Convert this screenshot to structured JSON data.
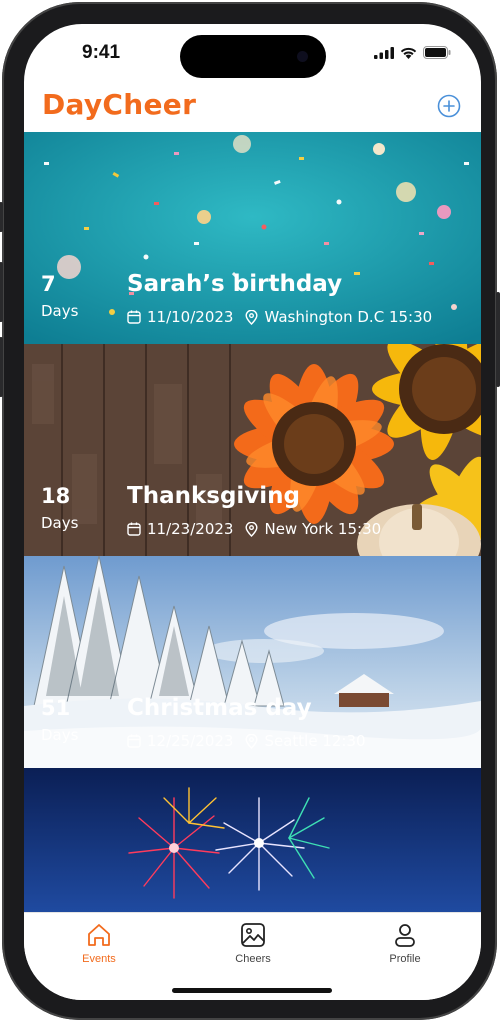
{
  "status_bar": {
    "time": "9:41"
  },
  "app": {
    "title": "DayCheer"
  },
  "header": {
    "add_icon": "plus-circle-icon",
    "accent": "#f26b1d",
    "add_color": "#4a90d9"
  },
  "events": [
    {
      "days": "7",
      "days_label": "Days",
      "title": "Sarah’s birthday",
      "date": "11/10/2023",
      "location": "Washington D.C 15:30",
      "theme": "confetti"
    },
    {
      "days": "18",
      "days_label": "Days",
      "title": "Thanksgiving",
      "date": "11/23/2023",
      "location": "New York 15:30",
      "theme": "sunflowers"
    },
    {
      "days": "51",
      "days_label": "Days",
      "title": "Christmas day",
      "date": "12/25/2023",
      "location": "Seattle 12:30",
      "theme": "snow"
    },
    {
      "theme": "fireworks"
    }
  ],
  "tabs": [
    {
      "label": "Events",
      "icon": "home-icon",
      "active": true
    },
    {
      "label": "Cheers",
      "icon": "image-icon",
      "active": false
    },
    {
      "label": "Profile",
      "icon": "person-icon",
      "active": false
    }
  ]
}
